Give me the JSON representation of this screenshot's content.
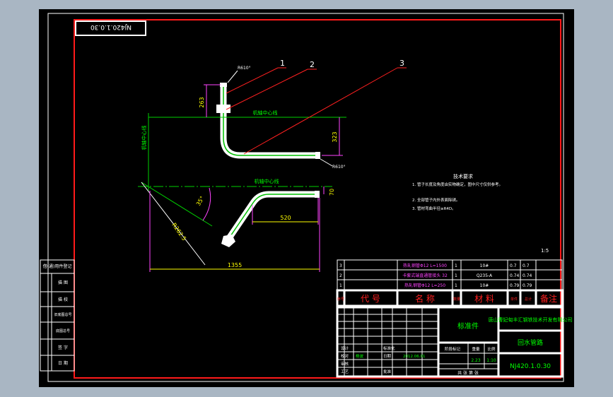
{
  "drawing_number_box": "NJ420.1.0.30",
  "balloons": [
    "1",
    "2",
    "3"
  ],
  "elevation": {
    "labels": {
      "bend_top": "R610°",
      "bend_bottom": "R610°",
      "centerline_label": "机轴中心线",
      "vertical_label": "机轴中心线",
      "dim_left": "263",
      "dim_right": "323"
    }
  },
  "plan": {
    "labels": {
      "centerline_label": "机轴中心线",
      "dim_70": "70",
      "dim_35": "35°",
      "dim_R": "R262.5",
      "dim_520": "520",
      "dim_1355": "1355"
    }
  },
  "tech_requirements": {
    "title": "技术要求",
    "items": [
      "1. 管子长度及角度由实物确定，图中尺寸仅供参考。",
      "2. 全部管子内外表面除锈。",
      "3. 管材弯曲半径≥R4D。"
    ]
  },
  "scale_note": "1:5",
  "left_column": [
    "借(通)用件登记",
    "描  图",
    "描  校",
    "旧底图总号",
    "底图总号",
    "签  字",
    "日  期"
  ],
  "bom": {
    "rows": [
      {
        "no": "3",
        "name": "热轧钢管Φ12  L=1500",
        "qty": "1",
        "material": "10#",
        "w1": "0.7",
        "w2": "0.7"
      },
      {
        "no": "2",
        "name": "卡套式端直通管接头 32",
        "qty": "1",
        "material": "Q235-A",
        "w1": "0.74",
        "w2": "0.74"
      },
      {
        "no": "1",
        "name": "热轧钢管Φ12  L=250",
        "qty": "1",
        "material": "10#",
        "w1": "0.79",
        "w2": "0.79"
      }
    ],
    "header": [
      "序号",
      "代    号",
      "名    称",
      "数量",
      "材    料",
      "单件",
      "总计",
      "备注"
    ]
  },
  "title_block": {
    "part_type": "标准件",
    "company": "唐山曹妃甸丰汇钢铁技术开发有限公司",
    "part_name": "回水管路",
    "drawing_no": "NJ420.1.0.30",
    "left_labels": [
      "设计",
      "校对",
      "审核",
      "工艺",
      "标准化",
      "批准"
    ],
    "designer": "杨波",
    "date_label": "日期",
    "stage_label": "阶段标记",
    "weight_label": "重量",
    "scale_label": "比例",
    "weight": "2.23",
    "scale": "1:10",
    "sheets": "共    张    第    张",
    "date_value": "2012.06.01"
  }
}
